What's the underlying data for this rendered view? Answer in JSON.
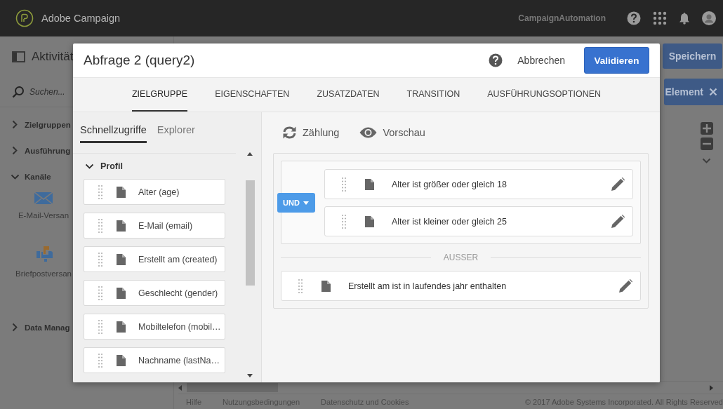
{
  "app_bar": {
    "product": "Adobe Campaign",
    "account": "CampaignAutomation"
  },
  "page": {
    "title": "Aktivität",
    "search": {
      "placeholder": "Suchen..."
    },
    "save_button": "Speichern",
    "element_button": "Element"
  },
  "sidebar": {
    "sections": [
      {
        "label": "Zielgruppen",
        "expanded": false
      },
      {
        "label": "Ausführung",
        "expanded": false
      },
      {
        "label": "Kanäle",
        "expanded": true,
        "children": [
          {
            "label": "E-Mail-Versan",
            "kind": "email"
          },
          {
            "label": "Briefpostversan",
            "kind": "letter"
          }
        ]
      },
      {
        "label": "Data Manag",
        "expanded": false
      }
    ]
  },
  "footer": {
    "links": [
      "Hilfe",
      "Nutzungsbedingungen",
      "Datenschutz und Cookies"
    ],
    "copyright": "© 2017 Adobe Systems Incorporated. All Rights Reserved"
  },
  "dialog": {
    "title": "Abfrage 2 (query2)",
    "cancel_button": "Abbrechen",
    "validate_button": "Validieren",
    "tabs": [
      {
        "label": "ZIELGRUPPE",
        "selected": true
      },
      {
        "label": "EIGENSCHAFTEN",
        "selected": false
      },
      {
        "label": "ZUSATZDATEN",
        "selected": false
      },
      {
        "label": "TRANSITION",
        "selected": false
      },
      {
        "label": "AUSFÜHRUNGSOPTIONEN",
        "selected": false
      }
    ],
    "palette": {
      "tabs": [
        {
          "label": "Schnellzugriffe",
          "selected": true
        },
        {
          "label": "Explorer",
          "selected": false
        }
      ],
      "groups": [
        {
          "label": "Profil",
          "expanded": true,
          "fields": [
            "Alter (age)",
            "E-Mail (email)",
            "Erstellt am (created)",
            "Geschlecht (gender)",
            "Mobiltelefon (mobil…",
            "Nachname (lastNa…"
          ]
        }
      ]
    },
    "toolbar": [
      {
        "label": "Zählung",
        "kind": "count"
      },
      {
        "label": "Vorschau",
        "kind": "preview"
      }
    ],
    "query": {
      "group": {
        "operator": "UND",
        "conditions": [
          "Alter ist größer oder gleich 18",
          "Alter ist kleiner oder gleich 25"
        ]
      },
      "exclusion_label": "AUSSER",
      "exclusions": [
        "Erstellt am ist in laufendes jahr enthalten"
      ]
    }
  }
}
